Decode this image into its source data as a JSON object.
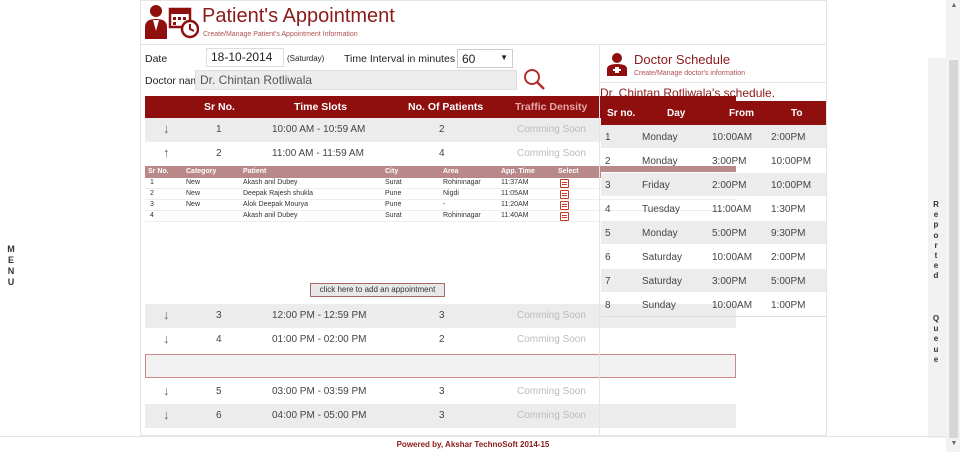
{
  "menu_label": [
    "M",
    "E",
    "N",
    "U"
  ],
  "reported_label": [
    "R",
    "e",
    "p",
    "o",
    "r",
    "t",
    "e",
    "d"
  ],
  "queue_label": [
    "Q",
    "u",
    "e",
    "u",
    "e"
  ],
  "header": {
    "title": "Patient's Appointment",
    "subtitle": "Create/Manage Patient's Appointment Information"
  },
  "form": {
    "date_label": "Date",
    "date_value": "18-10-2014",
    "day_label": "(Saturday)",
    "interval_label": "Time Interval in minutes",
    "interval_value": "60",
    "doctor_label": "Doctor name",
    "doctor_value": "Dr.  Chintan Rotliwala"
  },
  "slots": {
    "headers": [
      "Sr No.",
      "Time Slots",
      "No. Of Patients",
      "Traffic Density"
    ],
    "rows_top": [
      {
        "arrow": "↓",
        "sr": "1",
        "slot": "10:00 AM - 10:59 AM",
        "count": "2",
        "density": "Comming Soon"
      },
      {
        "arrow": "↑",
        "sr": "2",
        "slot": "11:00 AM - 11:59 AM",
        "count": "4",
        "density": "Comming Soon"
      }
    ],
    "rows_bottom": [
      {
        "arrow": "↓",
        "sr": "3",
        "slot": "12:00 PM - 12:59 PM",
        "count": "3",
        "density": "Comming Soon"
      },
      {
        "arrow": "↓",
        "sr": "4",
        "slot": "01:00 PM - 02:00 PM",
        "count": "2",
        "density": "Comming Soon"
      }
    ],
    "rows_end": [
      {
        "arrow": "↓",
        "sr": "5",
        "slot": "03:00 PM - 03:59 PM",
        "count": "3",
        "density": "Comming Soon"
      },
      {
        "arrow": "↓",
        "sr": "6",
        "slot": "04:00 PM - 05:00 PM",
        "count": "3",
        "density": "Comming Soon"
      }
    ]
  },
  "appointments": {
    "headers": [
      "Sr No.",
      "Category",
      "Patient",
      "City",
      "Area",
      "App. Time",
      "Select"
    ],
    "rows": [
      {
        "sr": "1",
        "category": "New",
        "patient": "Akash anil Dubey",
        "city": "Surat",
        "area": "Rohininagar",
        "time": "11:37AM"
      },
      {
        "sr": "2",
        "category": "New",
        "patient": "Deepak Rajesh shukla",
        "city": "Pune",
        "area": "Nigdi",
        "time": "11:05AM"
      },
      {
        "sr": "3",
        "category": "New",
        "patient": "Alok Deepak Mourya",
        "city": "Pune",
        "area": "-",
        "time": "11:20AM"
      },
      {
        "sr": "4",
        "category": "",
        "patient": "Akash anil Dubey",
        "city": "Surat",
        "area": "Rohininagar",
        "time": "11:40AM"
      }
    ],
    "add_button": "click here to add an appointment"
  },
  "doctor": {
    "title": "Doctor Schedule",
    "subtitle": "Create/Manage doctor's information",
    "schedule_title": "Dr. Chintan Rotliwala's schedule.",
    "headers": [
      "Sr no.",
      "Day",
      "From",
      "To"
    ],
    "rows": [
      {
        "sr": "1",
        "day": "Monday",
        "from": "10:00AM",
        "to": "2:00PM"
      },
      {
        "sr": "2",
        "day": "Monday",
        "from": "3:00PM",
        "to": "10:00PM"
      },
      {
        "sr": "3",
        "day": "Friday",
        "from": "2:00PM",
        "to": "10:00PM"
      },
      {
        "sr": "4",
        "day": "Tuesday",
        "from": "11:00AM",
        "to": "1:30PM"
      },
      {
        "sr": "5",
        "day": "Monday",
        "from": "5:00PM",
        "to": "9:30PM"
      },
      {
        "sr": "6",
        "day": "Saturday",
        "from": "10:00AM",
        "to": "2:00PM"
      },
      {
        "sr": "7",
        "day": "Saturday",
        "from": "3:00PM",
        "to": "5:00PM"
      },
      {
        "sr": "8",
        "day": "Sunday",
        "from": "10:00AM",
        "to": "1:00PM"
      }
    ]
  },
  "footer": "Powered by, Akshar TechnoSoft 2014-15",
  "colors": {
    "accent": "#8f0f0f",
    "title": "#8b1a1a",
    "sub_header": "#b98989"
  },
  "icons": [
    "doctor-calendar-icon",
    "search-icon",
    "doctor-icon",
    "edit-icon",
    "arrow-down-icon",
    "arrow-up-icon"
  ]
}
